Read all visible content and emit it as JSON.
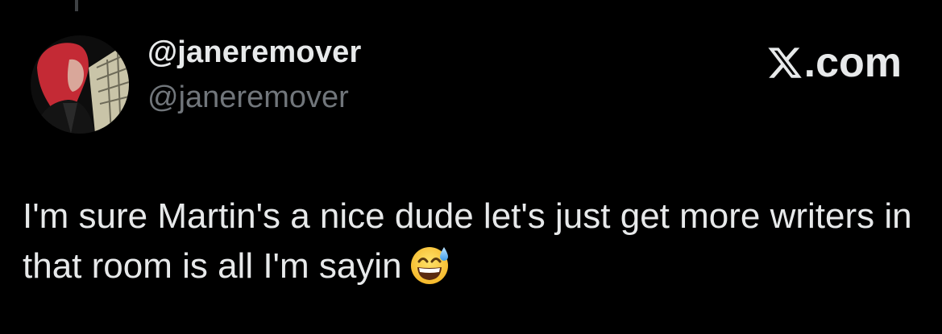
{
  "post": {
    "display_name": "@janeremover",
    "handle": "@janeremover",
    "brand": ".com",
    "brand_icon": "x-logo-icon",
    "text": "I'm sure Martin's a nice dude let's just get more writers in that room is all I'm sayin",
    "emoji": "grinning-face-with-sweat-icon"
  },
  "colors": {
    "background": "#000000",
    "primary_text": "#e7e9ea",
    "secondary_text": "#71767b"
  }
}
